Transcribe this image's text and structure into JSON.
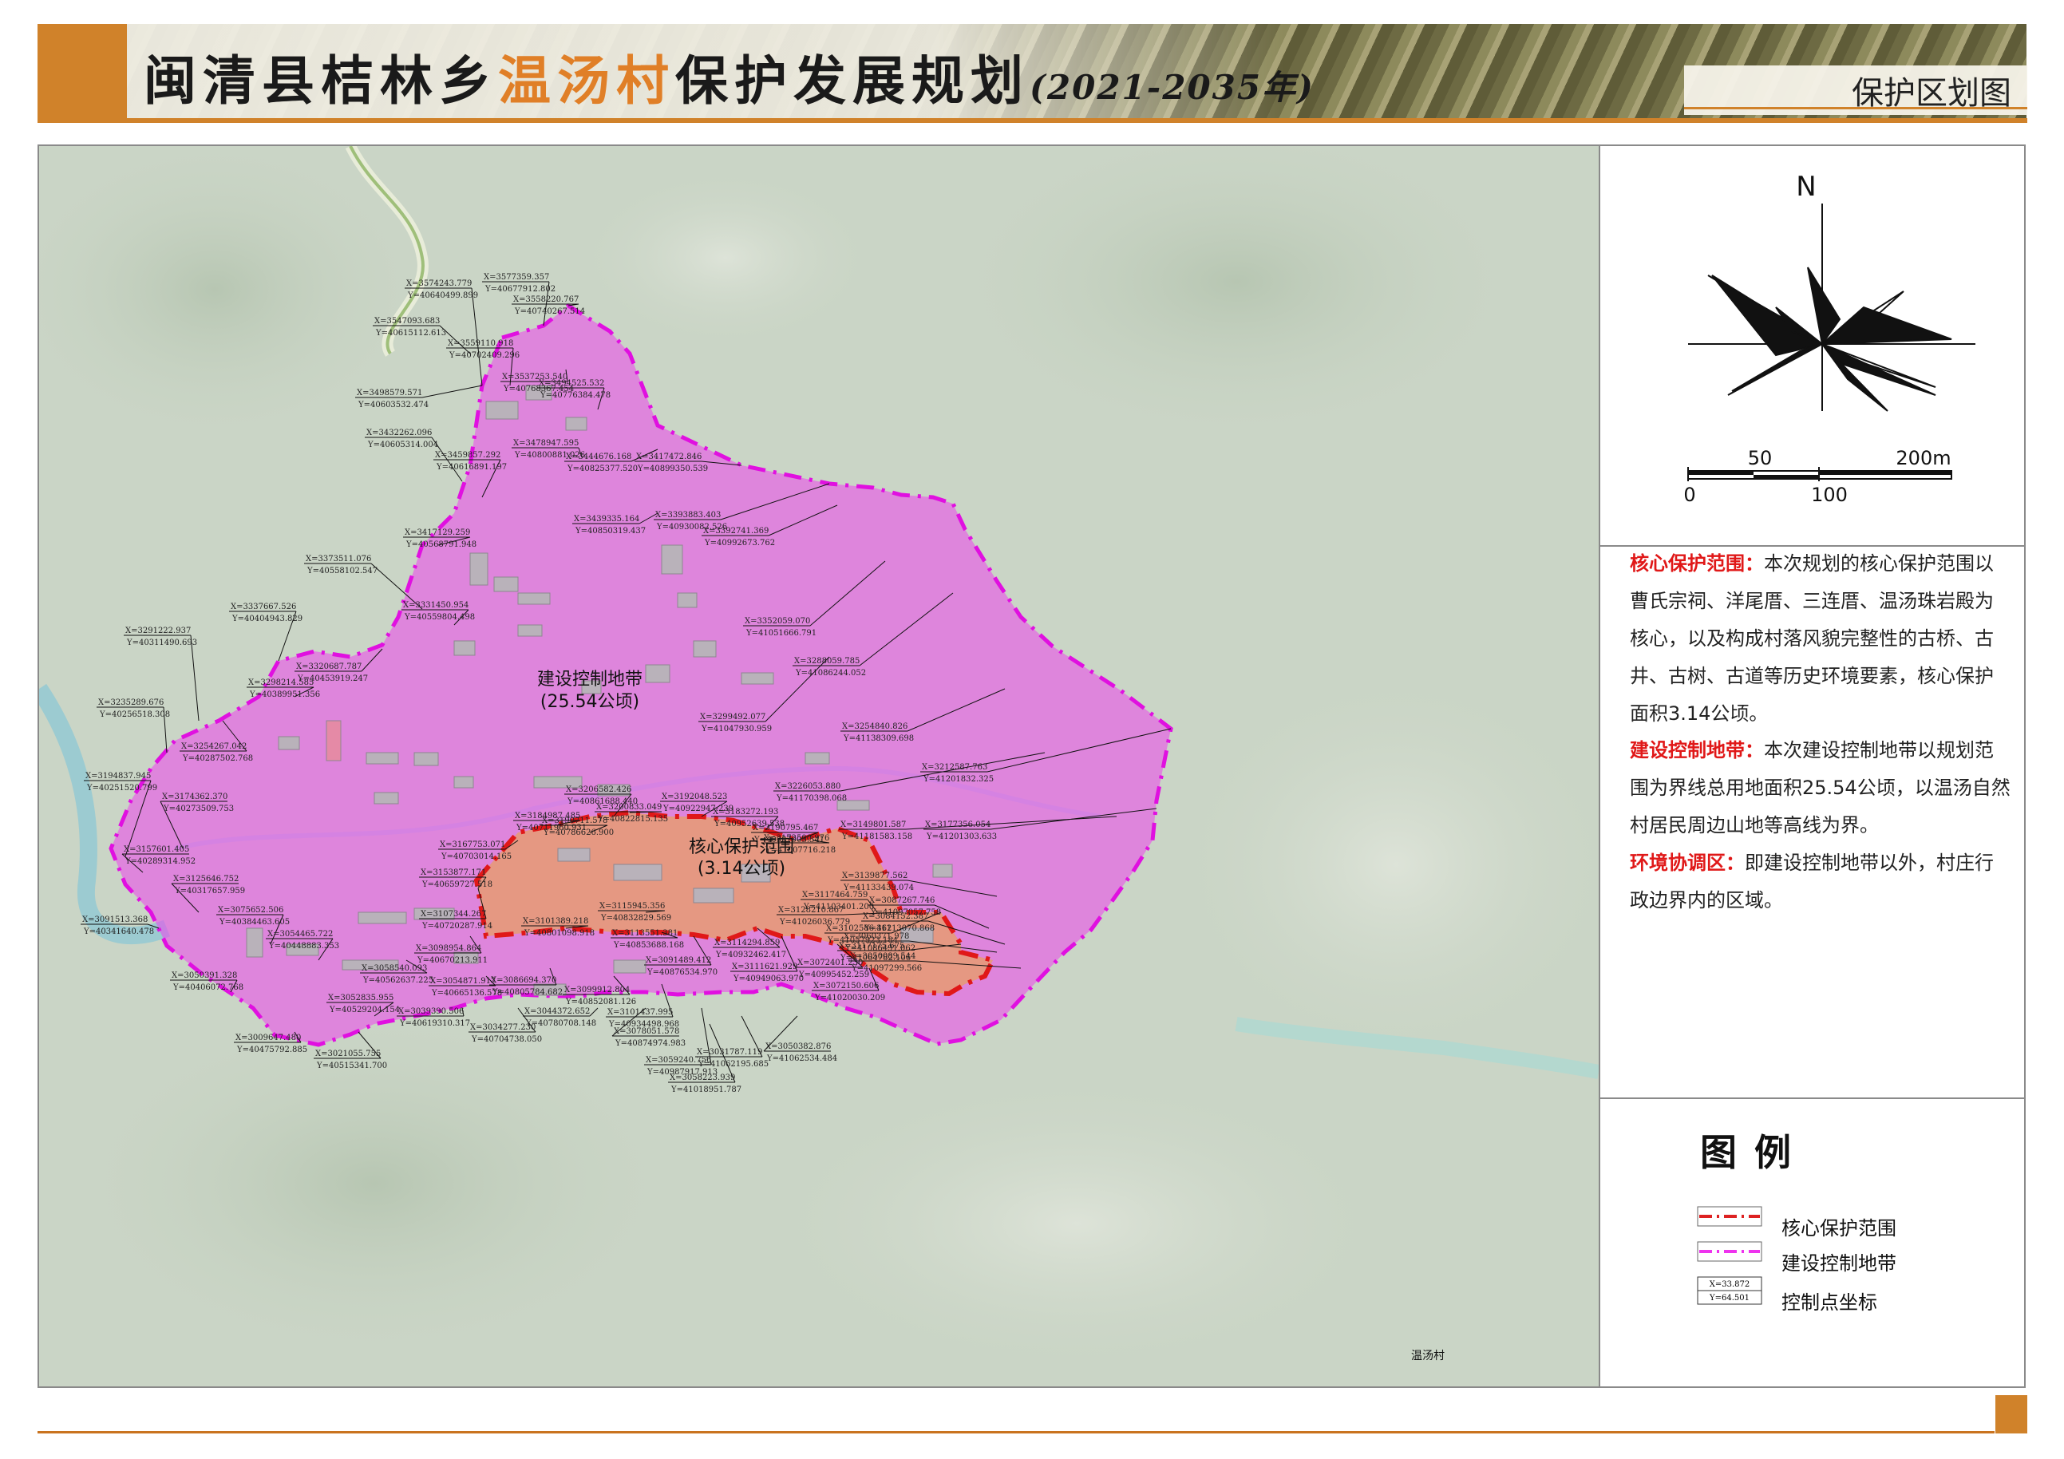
{
  "header": {
    "title_prefix": "闽清县桔林乡",
    "title_highlight": "温汤村",
    "title_suffix": "保护发展规划",
    "title_years": "(2021-2035年)",
    "page_subtitle": "保护区划图"
  },
  "map": {
    "zones": [
      {
        "name": "建设控制地带",
        "area": "(25.54公顷)",
        "color": "#ee44ee"
      },
      {
        "name": "核心保护范围",
        "area": "(3.14公顷)",
        "color": "#ee2222"
      }
    ],
    "village_label": "温汤村",
    "control_points": [
      {
        "x": "X=3574243.779",
        "y": "Y=40640499.899"
      },
      {
        "x": "X=3577359.357",
        "y": "Y=40677912.802"
      },
      {
        "x": "X=3558220.767",
        "y": "Y=40740267.514"
      },
      {
        "x": "X=3547093.683",
        "y": "Y=40615112.613"
      },
      {
        "x": "X=3559110.918",
        "y": "Y=40702409.296"
      },
      {
        "x": "X=3537253.540",
        "y": "Y=40768367.454"
      },
      {
        "x": "X=3498579.571",
        "y": "Y=40603532.474"
      },
      {
        "x": "X=3494525.532",
        "y": "Y=40776384.478"
      },
      {
        "x": "X=3432262.096",
        "y": "Y=40605314.004"
      },
      {
        "x": "X=3478947.595",
        "y": "Y=40800881.026"
      },
      {
        "x": "X=3444676.168",
        "y": "Y=40825377.520"
      },
      {
        "x": "X=3417472.846",
        "y": "Y=40899350.539"
      },
      {
        "x": "X=3459857.292",
        "y": "Y=40616891.197"
      },
      {
        "x": "X=3439335.164",
        "y": "Y=40850319.437"
      },
      {
        "x": "X=3393883.403",
        "y": "Y=40930082.526"
      },
      {
        "x": "X=3417129.259",
        "y": "Y=40568791.948"
      },
      {
        "x": "X=3392741.369",
        "y": "Y=40992673.762"
      },
      {
        "x": "X=3373511.076",
        "y": "Y=40558102.547"
      },
      {
        "x": "X=3337667.526",
        "y": "Y=40404943.829"
      },
      {
        "x": "X=3331450.954",
        "y": "Y=40559804.498"
      },
      {
        "x": "X=3352059.070",
        "y": "Y=41051666.791"
      },
      {
        "x": "X=3291222.937",
        "y": "Y=40311490.693"
      },
      {
        "x": "X=3320687.787",
        "y": "Y=40453919.247"
      },
      {
        "x": "X=3288059.785",
        "y": "Y=41086244.052"
      },
      {
        "x": "X=3298214.585",
        "y": "Y=40389951.356"
      },
      {
        "x": "X=3299492.077",
        "y": "Y=41047930.959"
      },
      {
        "x": "X=3235289.676",
        "y": "Y=40256518.308"
      },
      {
        "x": "X=3254840.826",
        "y": "Y=41138309.698"
      },
      {
        "x": "X=3254267.042",
        "y": "Y=40287502.768"
      },
      {
        "x": "X=3212587.763",
        "y": "Y=41201832.325"
      },
      {
        "x": "X=3194837.945",
        "y": "Y=40251520.799"
      },
      {
        "x": "X=3226053.880",
        "y": "Y=41170398.068"
      },
      {
        "x": "X=3174362.370",
        "y": "Y=40273509.753"
      },
      {
        "x": "X=3149801.587",
        "y": "Y=41181583.158"
      },
      {
        "x": "X=3177356.054",
        "y": "Y=41201303.633"
      },
      {
        "x": "X=3157601.405",
        "y": "Y=40289314.952"
      },
      {
        "x": "X=3125646.752",
        "y": "Y=40317657.959"
      },
      {
        "x": "X=3139877.562",
        "y": "Y=41133439.074"
      },
      {
        "x": "X=3087267.746",
        "y": "Y=41097057.758"
      },
      {
        "x": "X=3091513.368",
        "y": "Y=40341640.478"
      },
      {
        "x": "X=3075652.506",
        "y": "Y=40384463.605"
      },
      {
        "x": "X=3084152.387",
        "y": "Y=41113070.868"
      },
      {
        "x": "X=3060371.978",
        "y": "Y=41086491.062"
      },
      {
        "x": "X=3054465.722",
        "y": "Y=40448883.353"
      },
      {
        "x": "X=3050089.544",
        "y": "Y=41097299.566"
      },
      {
        "x": "X=3050391.328",
        "y": "Y=40406072.768"
      },
      {
        "x": "X=3052835.955",
        "y": "Y=40529204.154"
      },
      {
        "x": "X=3039390.506",
        "y": "Y=40619310.317"
      },
      {
        "x": "X=3034277.230",
        "y": "Y=40704738.050"
      },
      {
        "x": "X=3044372.652",
        "y": "Y=40780708.148"
      },
      {
        "x": "X=3009647.480",
        "y": "Y=40475792.885"
      },
      {
        "x": "X=3021055.755",
        "y": "Y=40515341.700"
      },
      {
        "x": "X=3059240.756",
        "y": "Y=40987917.913"
      },
      {
        "x": "X=3058223.939",
        "y": "Y=41018951.787"
      },
      {
        "x": "X=3031787.119",
        "y": "Y=41062195.685"
      },
      {
        "x": "X=3050382.876",
        "y": "Y=41062534.484"
      },
      {
        "x": "X=3078051.578",
        "y": "Y=40874974.983"
      },
      {
        "x": "X=3101437.995",
        "y": "Y=40934498.968"
      },
      {
        "x": "X=3099912.804",
        "y": "Y=40852081.126"
      },
      {
        "x": "X=3086694.370",
        "y": "Y=40805784.682"
      },
      {
        "x": "X=3054871.917",
        "y": "Y=40665136.578"
      },
      {
        "x": "X=3058540.093",
        "y": "Y=40562637.225"
      },
      {
        "x": "X=3098954.864",
        "y": "Y=40670213.911"
      },
      {
        "x": "X=3107344.267",
        "y": "Y=40720287.914"
      },
      {
        "x": "X=3153877.171",
        "y": "Y=40659727.518"
      },
      {
        "x": "X=3167753.071",
        "y": "Y=40703014.165"
      },
      {
        "x": "X=3184987.485",
        "y": "Y=40711960.931"
      },
      {
        "x": "X=3200833.049",
        "y": "Y=40822815.135"
      },
      {
        "x": "X=3206582.426",
        "y": "Y=40861688.440"
      },
      {
        "x": "X=3192048.523",
        "y": "Y=40922947.239"
      },
      {
        "x": "X=3183272.193",
        "y": "Y=40952639.538"
      },
      {
        "x": "X=3190795.467",
        "y": "Y=40987903.341"
      },
      {
        "x": "X=3190711.578",
        "y": "Y=40786626.900"
      },
      {
        "x": "X=3115945.356",
        "y": "Y=40832829.569"
      },
      {
        "x": "X=3101389.218",
        "y": "Y=40801098.918"
      },
      {
        "x": "X=3113551.381",
        "y": "Y=40853688.168"
      },
      {
        "x": "X=3091489.412",
        "y": "Y=40876534.970"
      },
      {
        "x": "X=3114294.859",
        "y": "Y=40932462.417"
      },
      {
        "x": "X=3111621.929",
        "y": "Y=40949063.970"
      },
      {
        "x": "X=3072401.230",
        "y": "Y=40995452.259"
      },
      {
        "x": "X=3072150.606",
        "y": "Y=41020030.209"
      },
      {
        "x": "X=3172500.976",
        "y": "Y=41007716.218"
      },
      {
        "x": "X=3117464.759",
        "y": "Y=41103401.200"
      },
      {
        "x": "X=3128210.867",
        "y": "Y=41026036.779"
      },
      {
        "x": "X=3102586.362",
        "y": "Y=41057923.184"
      },
      {
        "x": "X=3117175.675",
        "y": "Y=41064782.106"
      }
    ]
  },
  "compass": {
    "north": "N",
    "scale_top": [
      "50",
      "200m"
    ],
    "scale_bottom": [
      "0",
      "100"
    ]
  },
  "description": [
    {
      "key": "核心保护范围：",
      "text": "本次规划的核心保护范围以曹氏宗祠、洋尾厝、三连厝、温汤珠岩殿为核心，以及构成村落风貌完整性的古桥、古井、古树、古道等历史环境要素，核心保护面积3.14公顷。"
    },
    {
      "key": "建设控制地带：",
      "text": "本次建设控制地带以规划范围为界线总用地面积25.54公顷，以温汤自然村居民周边山地等高线为界。"
    },
    {
      "key": "环境协调区：",
      "text": "即建设控制地带以外，村庄行政边界内的区域。"
    }
  ],
  "legend": {
    "title": "图例",
    "items": [
      {
        "label": "核心保护范围",
        "color": "#dd2222"
      },
      {
        "label": "建设控制地带",
        "color": "#ee33ee"
      },
      {
        "label": "控制点坐标",
        "sample_x": "X=33.872",
        "sample_y": "Y=64.501"
      }
    ]
  }
}
